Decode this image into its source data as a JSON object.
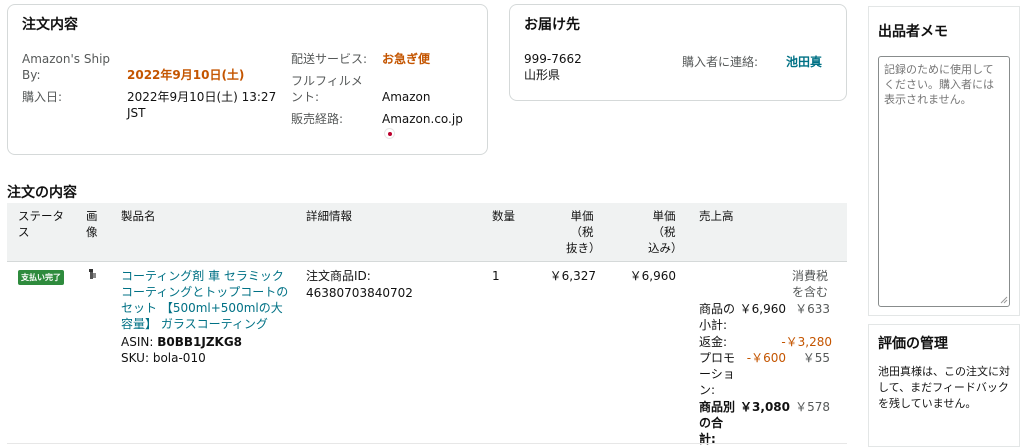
{
  "order_content": {
    "title": "注文内容",
    "ship_by_label": "Amazon's Ship By:",
    "ship_by_value": "2022年9月10日(土)",
    "purchase_date_label": "購入日:",
    "purchase_date_value": "2022年9月10日(土) 13:27 JST",
    "shipping_service_label": "配送サービス:",
    "shipping_service_value": "お急ぎ便",
    "fulfillment_label": "フルフィルメント:",
    "fulfillment_value": "Amazon",
    "sales_channel_label": "販売経路:",
    "sales_channel_value": "Amazon.co.jp"
  },
  "delivery": {
    "title": "お届け先",
    "postal_code": "999-7662",
    "prefecture": "山形県",
    "contact_label": "購入者に連絡:",
    "contact_name": "池田真"
  },
  "order_items": {
    "title": "注文の内容",
    "headers": {
      "status": "ステータス",
      "image": "画像",
      "product_name": "製品名",
      "details": "詳細情報",
      "quantity": "数量",
      "unit_price_ex_tax": "単価（税抜き）",
      "unit_price_in_tax": "単価（税込み）",
      "sales": "売上高"
    },
    "row": {
      "status_badge": "支払い完了",
      "product_title": "コーティング剤 車 セラミックコーティングとトップコートのセット 【500ml+500mlの大容量】 ガラスコーティング",
      "asin_label": "ASIN:",
      "asin_value": "B0BB1JZKG8",
      "sku_label": "SKU:",
      "sku_value": "bola-010",
      "order_item_id_label": "注文商品ID:",
      "order_item_id_value": "46380703840702",
      "quantity": "1",
      "unit_price_ex_tax": "￥6,327",
      "unit_price_in_tax": "￥6,960"
    },
    "sales": {
      "tax_included_label": "消費税を含む",
      "subtotal_label": "商品の小計:",
      "subtotal_value": "￥6,960",
      "subtotal_tax": "￥633",
      "refund_label": "返金:",
      "refund_tax": "-￥3,280",
      "promotion_label": "プロモーション:",
      "promotion_value": "-￥600",
      "promotion_tax": "￥55",
      "total_label": "商品別の合計:",
      "total_value": "￥3,080",
      "total_tax": "￥578"
    }
  },
  "seller_memo": {
    "title": "出品者メモ",
    "placeholder": "記録のために使用してください。購入者には表示されません。"
  },
  "feedback": {
    "title": "評価の管理",
    "text": "池田真様は、この注文に対して、まだフィードバックを残していません。"
  },
  "colors": {
    "accent_orange": "#c45500",
    "link_teal": "#007185",
    "badge_green": "#2e8b3d",
    "border": "#d5d9d9"
  }
}
